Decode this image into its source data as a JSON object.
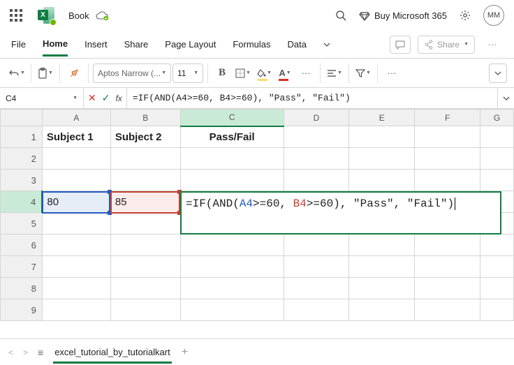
{
  "titlebar": {
    "doc_title": "Book",
    "buy_label": "Buy Microsoft 365",
    "avatar_initials": "MM",
    "excel_x": "X"
  },
  "tabs": {
    "file": "File",
    "home": "Home",
    "insert": "Insert",
    "share": "Share",
    "page_layout": "Page Layout",
    "formulas": "Formulas",
    "data": "Data",
    "share_btn": "Share"
  },
  "toolbar": {
    "font_name": "Aptos Narrow (...",
    "font_size": "11",
    "bold": "B",
    "fill_letter": "",
    "font_letter": "A",
    "dots": "···"
  },
  "formula_bar": {
    "active_cell": "C4",
    "formula": "=IF(AND(A4>=60, B4>=60), \"Pass\", \"Fail\")"
  },
  "columns": [
    "A",
    "B",
    "C",
    "D",
    "E",
    "F",
    "G"
  ],
  "rows": [
    "1",
    "2",
    "3",
    "4",
    "5",
    "6",
    "7",
    "8",
    "9"
  ],
  "sheet": {
    "A1": "Subject 1",
    "B1": "Subject 2",
    "C1": "Pass/Fail",
    "A4": "80",
    "B4": "85"
  },
  "editor": {
    "prefix": "=IF(AND(",
    "refA": "A4",
    "mid1": ">=60, ",
    "refB": "B4",
    "mid2": ">=60), \"Pass\", \"Fail\")"
  },
  "statusbar": {
    "sheet_name": "excel_tutorial_by_tutorialkart"
  },
  "chart_data": {
    "type": "table",
    "title": "",
    "columns": [
      "Subject 1",
      "Subject 2",
      "Pass/Fail"
    ],
    "rows": [
      {
        "Subject 1": 80,
        "Subject 2": 85,
        "Pass/Fail": "=IF(AND(A4>=60, B4>=60), \"Pass\", \"Fail\")"
      }
    ]
  }
}
